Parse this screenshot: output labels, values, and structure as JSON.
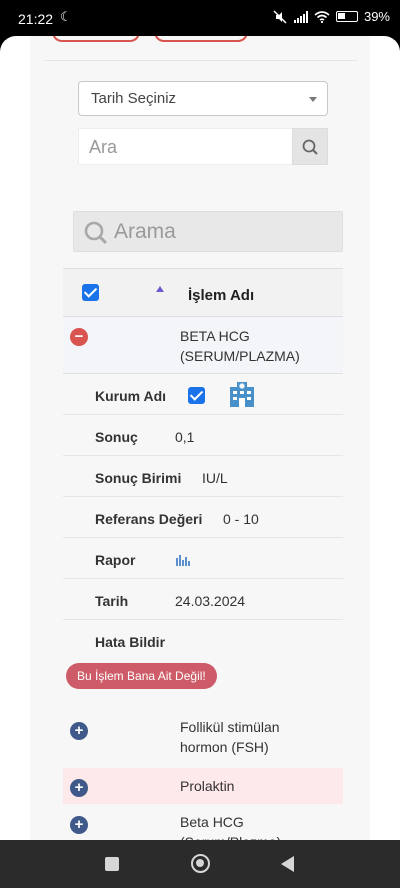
{
  "status_bar": {
    "time": "21:22",
    "battery": "39%",
    "icons": [
      "moon-icon",
      "mute-icon",
      "signal-icon",
      "wifi-icon",
      "battery-icon"
    ]
  },
  "filters": {
    "date_select": "Tarih Seçiniz",
    "search_placeholder": "Ara",
    "search_icon": "search-icon"
  },
  "arama": {
    "placeholder": "Arama"
  },
  "table": {
    "header": {
      "label": "İşlem Adı"
    },
    "expanded_row": {
      "name": "BETA HCG (SERUM/PLAZMA)",
      "details": {
        "kurum_label": "Kurum Adı",
        "sonuc_label": "Sonuç",
        "sonuc_value": "0,1",
        "birim_label": "Sonuç Birimi",
        "birim_value": "IU/L",
        "referans_label": "Referans Değeri",
        "referans_value": "0 - 10",
        "rapor_label": "Rapor",
        "tarih_label": "Tarih",
        "tarih_value": "24.03.2024",
        "hata_label": "Hata Bildir",
        "hata_button": "Bu İşlem Bana Ait Değil!"
      }
    },
    "rows": [
      {
        "name": "Follikül stimülan hormon (FSH)",
        "highlight": false
      },
      {
        "name": "Prolaktin",
        "highlight": true
      },
      {
        "name": "Beta HCG (Serum/Plazma)",
        "highlight": false
      }
    ]
  },
  "colors": {
    "accent_blue": "#1a73e8",
    "danger": "#d9534f",
    "plus_toggle": "#3f5a8a",
    "highlight_row": "#fde8ea"
  }
}
